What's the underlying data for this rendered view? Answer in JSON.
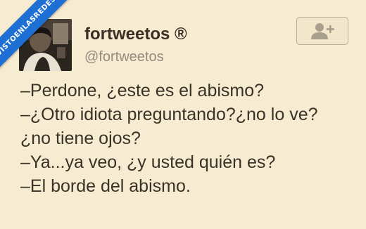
{
  "watermark": {
    "text": "VISTOENLASREDES"
  },
  "profile": {
    "display_name": "fortweetos ®",
    "handle": "@fortweetos"
  },
  "follow_button": {
    "icon": "add-user-icon"
  },
  "tweet": {
    "lines": [
      "–Perdone, ¿este es el abismo?",
      "–¿Otro idiota preguntando?¿no lo ve?",
      "¿no tiene ojos?",
      "–Ya...ya veo, ¿y usted quién es?",
      "–El borde del abismo."
    ]
  },
  "colors": {
    "background": "#f6ecd2",
    "ribbon": "#1e6fd3",
    "text": "#3b3227",
    "handle": "#948b7d"
  }
}
